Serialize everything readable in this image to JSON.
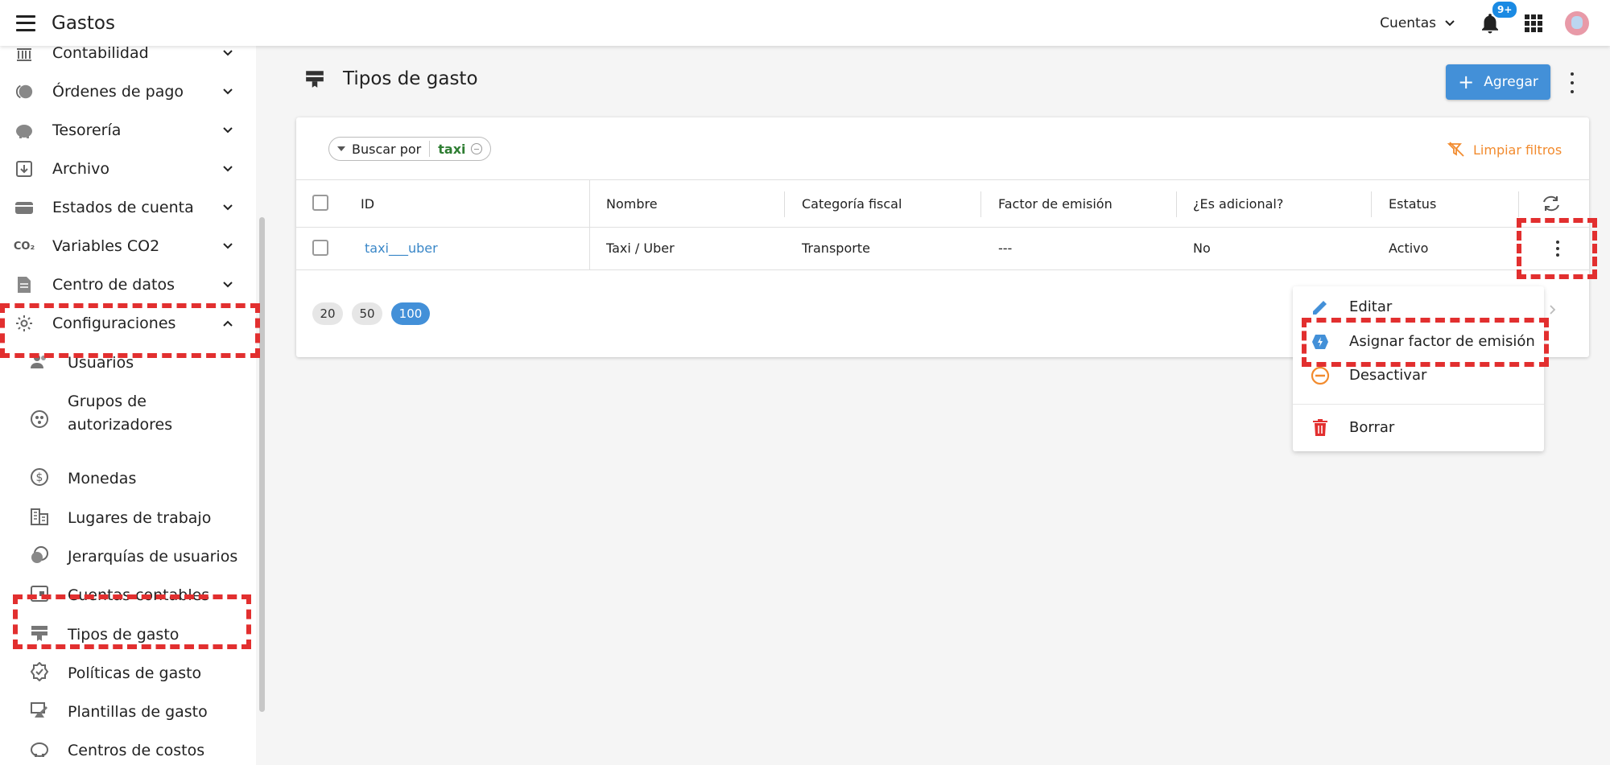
{
  "app": {
    "title": "Gastos"
  },
  "header": {
    "accounts_label": "Cuentas",
    "notifications_badge": "9+"
  },
  "sidebar": {
    "items": [
      {
        "label": "Contabilidad",
        "icon": "bank-icon"
      },
      {
        "label": "Órdenes de pago",
        "icon": "coins-icon"
      },
      {
        "label": "Tesorería",
        "icon": "piggy-bank-icon"
      },
      {
        "label": "Archivo",
        "icon": "archive-icon"
      },
      {
        "label": "Estados de cuenta",
        "icon": "wallet-icon"
      },
      {
        "label": "Variables CO2",
        "icon": "co2-icon"
      },
      {
        "label": "Centro de datos",
        "icon": "document-icon"
      },
      {
        "label": "Configuraciones",
        "icon": "gear-icon"
      }
    ],
    "sub_items": [
      {
        "label": "Usuarios",
        "icon": "users-icon"
      },
      {
        "label": "Grupos de autorizadores",
        "icon": "group-icon"
      },
      {
        "label": "Monedas",
        "icon": "dollar-icon"
      },
      {
        "label": "Lugares de trabajo",
        "icon": "building-icon"
      },
      {
        "label": "Jerarquías de usuarios",
        "icon": "hierarchy-icon"
      },
      {
        "label": "Cuentas contables",
        "icon": "ledger-icon"
      },
      {
        "label": "Tipos de gasto",
        "icon": "receipt-icon"
      },
      {
        "label": "Políticas de gasto",
        "icon": "policy-badge-icon"
      },
      {
        "label": "Plantillas de gasto",
        "icon": "template-icon"
      },
      {
        "label": "Centros de costos",
        "icon": "piggy-bank-icon"
      }
    ]
  },
  "main": {
    "page_title": "Tipos de gasto",
    "add_button": "Agregar",
    "filter": {
      "label": "Buscar por",
      "term": "taxi"
    },
    "clear_filters": "Limpiar filtros",
    "table": {
      "columns": [
        "ID",
        "Nombre",
        "Categoría fiscal",
        "Factor de emisión",
        "¿Es adicional?",
        "Estatus"
      ],
      "rows": [
        {
          "id": "taxi___uber",
          "nombre": "Taxi / Uber",
          "categoria": "Transporte",
          "factor": "---",
          "adicional": "No",
          "estatus": "Activo"
        }
      ]
    },
    "page_sizes": [
      "20",
      "50",
      "100"
    ],
    "page_size_selected": "100"
  },
  "context_menu": {
    "items": [
      {
        "label": "Editar",
        "icon": "pencil-icon",
        "color": "#4390d8"
      },
      {
        "label": "Asignar factor de emisión",
        "icon": "emission-factor-icon",
        "color": "#4390d8"
      },
      {
        "label": "Desactivar",
        "icon": "minus-circle-icon",
        "color": "#f28b2e"
      },
      {
        "label": "Borrar",
        "icon": "trash-icon",
        "color": "#e22f2f"
      }
    ]
  },
  "colors": {
    "primary": "#4390d8",
    "link": "#3a87c8",
    "warning": "#f28b2e",
    "danger": "#e22f2f",
    "filter_term": "#2e7d32"
  }
}
